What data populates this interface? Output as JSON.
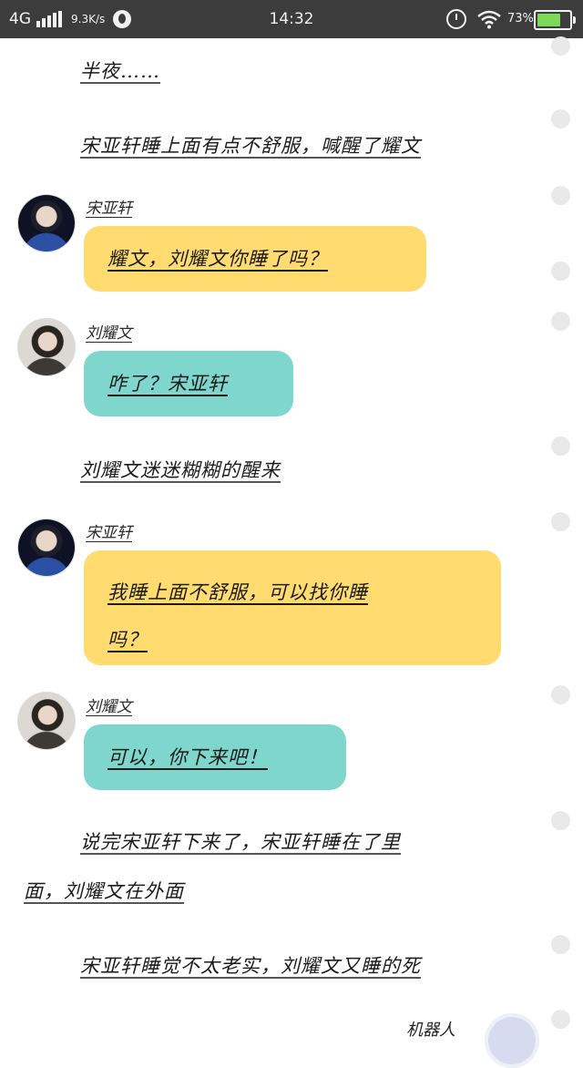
{
  "status_bar": {
    "network": "4G",
    "speed": "9.3K/s",
    "time": "14:32",
    "battery_pct": "73%",
    "battery_level": 0.73,
    "battery_color": "#7ed957",
    "icons": [
      "signal-icon",
      "app-icon",
      "alarm-icon",
      "wifi-icon",
      "battery-icon"
    ]
  },
  "story": {
    "line1": "半夜……",
    "line2": "宋亚轩睡上面有点不舒服，喊醒了耀文",
    "line3": "刘耀文迷迷糊糊的醒来",
    "line4a": "说完宋亚轩下来了，宋亚轩睡在了里",
    "line4b": "面，刘耀文在外面",
    "line5": "宋亚轩睡觉不太老实，刘耀文又睡的死"
  },
  "messages": [
    {
      "speaker": "宋亚轩",
      "text": "耀文，刘耀文你睡了吗？",
      "color": "#ffdb70"
    },
    {
      "speaker": "刘耀文",
      "text": "咋了？宋亚轩",
      "color": "#7ed6cc"
    },
    {
      "speaker": "宋亚轩",
      "text_line1": "我睡上面不舒服，可以找你睡",
      "text_line2": "吗？",
      "color": "#ffdb70"
    },
    {
      "speaker": "刘耀文",
      "text": "可以，你下来吧！",
      "color": "#7ed6cc"
    }
  ],
  "robot_label": "机器人"
}
